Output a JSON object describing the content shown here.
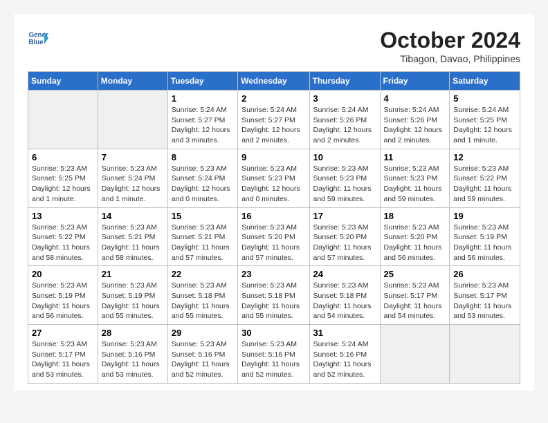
{
  "header": {
    "logo_line1": "General",
    "logo_line2": "Blue",
    "month_title": "October 2024",
    "subtitle": "Tibagon, Davao, Philippines"
  },
  "weekdays": [
    "Sunday",
    "Monday",
    "Tuesday",
    "Wednesday",
    "Thursday",
    "Friday",
    "Saturday"
  ],
  "weeks": [
    [
      {
        "day": "",
        "info": ""
      },
      {
        "day": "",
        "info": ""
      },
      {
        "day": "1",
        "info": "Sunrise: 5:24 AM\nSunset: 5:27 PM\nDaylight: 12 hours\nand 3 minutes."
      },
      {
        "day": "2",
        "info": "Sunrise: 5:24 AM\nSunset: 5:27 PM\nDaylight: 12 hours\nand 2 minutes."
      },
      {
        "day": "3",
        "info": "Sunrise: 5:24 AM\nSunset: 5:26 PM\nDaylight: 12 hours\nand 2 minutes."
      },
      {
        "day": "4",
        "info": "Sunrise: 5:24 AM\nSunset: 5:26 PM\nDaylight: 12 hours\nand 2 minutes."
      },
      {
        "day": "5",
        "info": "Sunrise: 5:24 AM\nSunset: 5:25 PM\nDaylight: 12 hours\nand 1 minute."
      }
    ],
    [
      {
        "day": "6",
        "info": "Sunrise: 5:23 AM\nSunset: 5:25 PM\nDaylight: 12 hours\nand 1 minute."
      },
      {
        "day": "7",
        "info": "Sunrise: 5:23 AM\nSunset: 5:24 PM\nDaylight: 12 hours\nand 1 minute."
      },
      {
        "day": "8",
        "info": "Sunrise: 5:23 AM\nSunset: 5:24 PM\nDaylight: 12 hours\nand 0 minutes."
      },
      {
        "day": "9",
        "info": "Sunrise: 5:23 AM\nSunset: 5:23 PM\nDaylight: 12 hours\nand 0 minutes."
      },
      {
        "day": "10",
        "info": "Sunrise: 5:23 AM\nSunset: 5:23 PM\nDaylight: 11 hours\nand 59 minutes."
      },
      {
        "day": "11",
        "info": "Sunrise: 5:23 AM\nSunset: 5:23 PM\nDaylight: 11 hours\nand 59 minutes."
      },
      {
        "day": "12",
        "info": "Sunrise: 5:23 AM\nSunset: 5:22 PM\nDaylight: 11 hours\nand 59 minutes."
      }
    ],
    [
      {
        "day": "13",
        "info": "Sunrise: 5:23 AM\nSunset: 5:22 PM\nDaylight: 11 hours\nand 58 minutes."
      },
      {
        "day": "14",
        "info": "Sunrise: 5:23 AM\nSunset: 5:21 PM\nDaylight: 11 hours\nand 58 minutes."
      },
      {
        "day": "15",
        "info": "Sunrise: 5:23 AM\nSunset: 5:21 PM\nDaylight: 11 hours\nand 57 minutes."
      },
      {
        "day": "16",
        "info": "Sunrise: 5:23 AM\nSunset: 5:20 PM\nDaylight: 11 hours\nand 57 minutes."
      },
      {
        "day": "17",
        "info": "Sunrise: 5:23 AM\nSunset: 5:20 PM\nDaylight: 11 hours\nand 57 minutes."
      },
      {
        "day": "18",
        "info": "Sunrise: 5:23 AM\nSunset: 5:20 PM\nDaylight: 11 hours\nand 56 minutes."
      },
      {
        "day": "19",
        "info": "Sunrise: 5:23 AM\nSunset: 5:19 PM\nDaylight: 11 hours\nand 56 minutes."
      }
    ],
    [
      {
        "day": "20",
        "info": "Sunrise: 5:23 AM\nSunset: 5:19 PM\nDaylight: 11 hours\nand 56 minutes."
      },
      {
        "day": "21",
        "info": "Sunrise: 5:23 AM\nSunset: 5:19 PM\nDaylight: 11 hours\nand 55 minutes."
      },
      {
        "day": "22",
        "info": "Sunrise: 5:23 AM\nSunset: 5:18 PM\nDaylight: 11 hours\nand 55 minutes."
      },
      {
        "day": "23",
        "info": "Sunrise: 5:23 AM\nSunset: 5:18 PM\nDaylight: 11 hours\nand 55 minutes."
      },
      {
        "day": "24",
        "info": "Sunrise: 5:23 AM\nSunset: 5:18 PM\nDaylight: 11 hours\nand 54 minutes."
      },
      {
        "day": "25",
        "info": "Sunrise: 5:23 AM\nSunset: 5:17 PM\nDaylight: 11 hours\nand 54 minutes."
      },
      {
        "day": "26",
        "info": "Sunrise: 5:23 AM\nSunset: 5:17 PM\nDaylight: 11 hours\nand 53 minutes."
      }
    ],
    [
      {
        "day": "27",
        "info": "Sunrise: 5:23 AM\nSunset: 5:17 PM\nDaylight: 11 hours\nand 53 minutes."
      },
      {
        "day": "28",
        "info": "Sunrise: 5:23 AM\nSunset: 5:16 PM\nDaylight: 11 hours\nand 53 minutes."
      },
      {
        "day": "29",
        "info": "Sunrise: 5:23 AM\nSunset: 5:16 PM\nDaylight: 11 hours\nand 52 minutes."
      },
      {
        "day": "30",
        "info": "Sunrise: 5:23 AM\nSunset: 5:16 PM\nDaylight: 11 hours\nand 52 minutes."
      },
      {
        "day": "31",
        "info": "Sunrise: 5:24 AM\nSunset: 5:16 PM\nDaylight: 11 hours\nand 52 minutes."
      },
      {
        "day": "",
        "info": ""
      },
      {
        "day": "",
        "info": ""
      }
    ]
  ]
}
